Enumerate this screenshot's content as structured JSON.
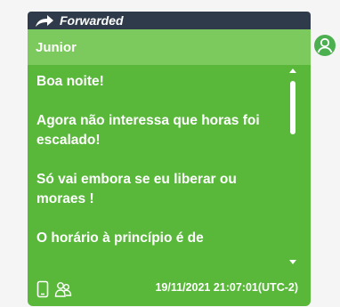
{
  "forwarded": {
    "label": "Forwarded",
    "icon": "forward-arrow-icon"
  },
  "message": {
    "sender": "Junior",
    "paragraphs": [
      "Boa noite!",
      "Agora não interessa que horas foi escalado!",
      "Só vai embora se eu liberar ou moraes !",
      "O horário à princípio é de"
    ],
    "timestamp": "19/11/2021 21:07:01(UTC-2)"
  },
  "icons": {
    "footer_left": "phone-icon",
    "footer_right": "group-icon",
    "avatar": "user-avatar-icon"
  },
  "colors": {
    "bubble": "#59b83a",
    "sender_bar": "#7cc95d",
    "forwarded_bar": "#2f3b4a",
    "background": "#f5f5f5",
    "avatar": "#4caf50"
  }
}
